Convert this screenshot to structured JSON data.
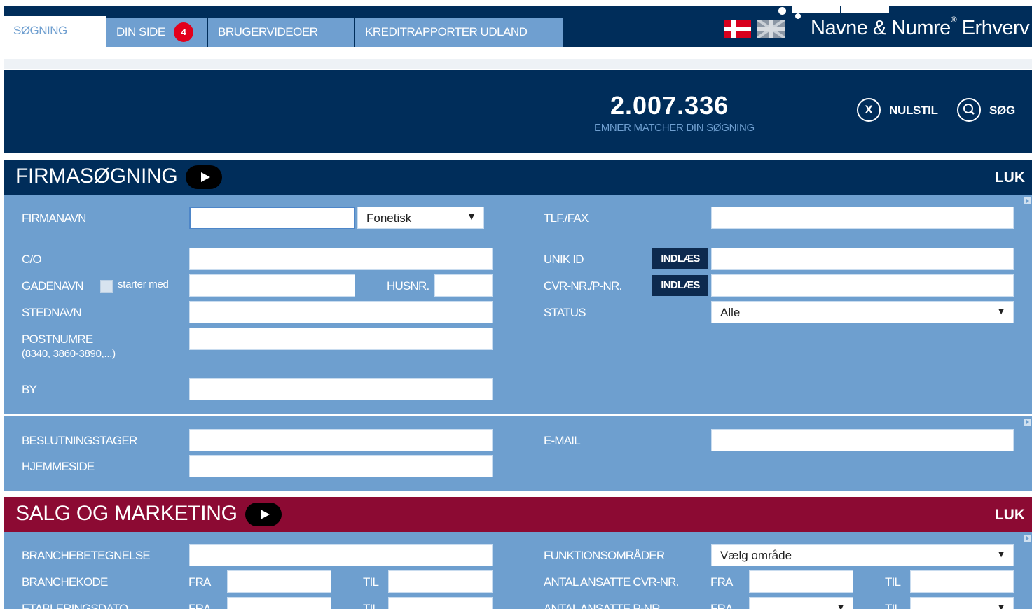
{
  "nav": {
    "tabs": [
      {
        "label": "SØGNING",
        "active": true
      },
      {
        "label": "DIN SIDE",
        "badge": "4"
      },
      {
        "label": "BRUGERVIDEOER"
      },
      {
        "label": "KREDITRAPPORTER UDLAND"
      }
    ],
    "brand": "Navne & Numre",
    "brand_mark": "®",
    "brand_suffix": "Erhverv",
    "flags": [
      "danish-flag-icon",
      "uk-flag-icon"
    ]
  },
  "counter": {
    "value": "2.007.336",
    "caption": "EMNER MATCHER DIN SØGNING",
    "reset_icon": "X",
    "reset_label": "NULSTIL",
    "search_label": "SØG"
  },
  "firma": {
    "title": "FIRMASØGNING",
    "close": "LUK",
    "fields": {
      "firmanavn": "FIRMANAVN",
      "firmanavn_mode": "Fonetisk",
      "co": "C/O",
      "gadenavn": "GADENAVN",
      "starter_med": "starter med",
      "husnr": "HUSNR.",
      "stednavn": "STEDNAVN",
      "postnumre": "POSTNUMRE",
      "postnumre_hint": "(8340, 3860-3890,...)",
      "by": "BY",
      "tlf": "TLF./FAX",
      "unik_id": "UNIK ID",
      "cvr": "CVR-NR./P-NR.",
      "indlaes": "INDLÆS",
      "status": "STATUS",
      "status_value": "Alle",
      "beslutningstager": "BESLUTNINGSTAGER",
      "hjemmeside": "HJEMMESIDE",
      "email": "E-MAIL"
    }
  },
  "salg": {
    "title": "SALG OG MARKETING",
    "close": "LUK",
    "fields": {
      "branchebetegnelse": "BRANCHEBETEGNELSE",
      "branchekode": "BRANCHEKODE",
      "etableringsdato": "ETABLERINGSDATO",
      "fra": "FRA",
      "til": "TIL",
      "funktionsomraader": "FUNKTIONSOMRÅDER",
      "funktion_value": "Vælg område",
      "ansatte_cvr": "ANTAL ANSATTE CVR-NR.",
      "ansatte_p": "ANTAL ANSATTE P-NR."
    }
  },
  "colors": {
    "navy": "#002d5a",
    "panel_blue": "#6e9fcf",
    "maroon": "#8c0a33",
    "badge_red": "#e3001b"
  }
}
